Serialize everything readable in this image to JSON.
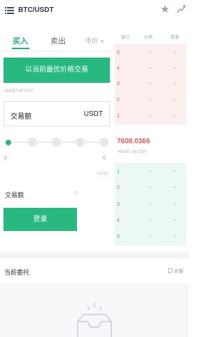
{
  "header": {
    "menu_icon": "menu-list-icon",
    "pair": "BTC/USDT",
    "star_icon": "star-icon",
    "chart_icon": "kline-chart-icon"
  },
  "tabs": {
    "buy": "买入",
    "sell": "卖出",
    "order_type": "市价"
  },
  "form": {
    "best_price_button": "以当前最优价格交易",
    "cny_estimate": "≈54397.46 CNY",
    "amount_label": "交易额",
    "amount_unit": "USDT",
    "slider_level": 0,
    "slider_min": "0",
    "slider_max": "0",
    "available": "≈0.00",
    "trade_amount_label": "交易额",
    "trade_amount_value": "0",
    "login_button": "登录"
  },
  "order_book": {
    "headers": [
      "盘口",
      "价格",
      "数量"
    ],
    "asks": [
      {
        "level": "5",
        "price": "--",
        "qty": "--"
      },
      {
        "level": "4",
        "price": "--",
        "qty": "--"
      },
      {
        "level": "3",
        "price": "--",
        "qty": "--"
      },
      {
        "level": "2",
        "price": "--",
        "qty": "--"
      },
      {
        "level": "1",
        "price": "--",
        "qty": "--"
      }
    ],
    "last_price": "7608.0366",
    "last_price_cny": "≈54397.46 CNY",
    "bids": [
      {
        "level": "1",
        "price": "--",
        "qty": "--"
      },
      {
        "level": "2",
        "price": "--",
        "qty": "--"
      },
      {
        "level": "3",
        "price": "--",
        "qty": "--"
      },
      {
        "level": "4",
        "price": "--",
        "qty": "--"
      },
      {
        "level": "5",
        "price": "--",
        "qty": "--"
      }
    ]
  },
  "orders": {
    "title": "当前委托",
    "all_label": "全部",
    "empty_icon": "empty-box-icon"
  },
  "colors": {
    "accent_green": "#27b97f",
    "accent_red": "#e15a5a",
    "ask_background": "#fbeeee",
    "bid_background": "#ecf8f2"
  }
}
